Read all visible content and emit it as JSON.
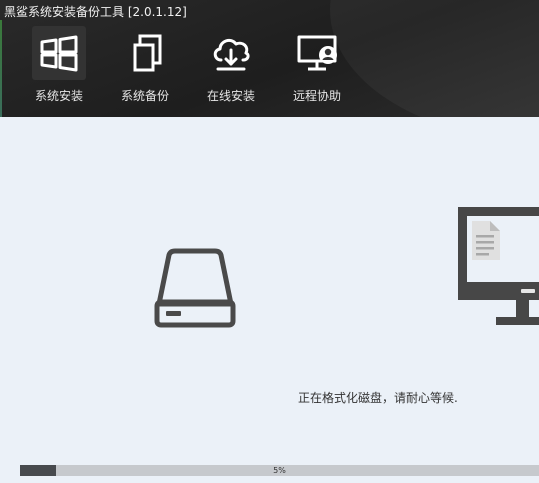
{
  "app": {
    "title": "黑鲨系统安装备份工具 [2.0.1.12]"
  },
  "tabs": [
    {
      "label": "系统安装",
      "icon": "windows-icon",
      "active": true
    },
    {
      "label": "系统备份",
      "icon": "copy-icon",
      "active": false
    },
    {
      "label": "在线安装",
      "icon": "cloud-download-icon",
      "active": false
    },
    {
      "label": "远程协助",
      "icon": "remote-support-icon",
      "active": false
    }
  ],
  "main": {
    "status_text": "正在格式化磁盘，请耐心等候.",
    "progress": {
      "value": 0.05,
      "text": "5%"
    }
  },
  "colors": {
    "titlebar": "#222222",
    "content_bg": "#ebf1f8",
    "icon_dark": "#4a4a4a",
    "progress_fill": "#474a4e",
    "progress_track": "#c6c9cd"
  }
}
